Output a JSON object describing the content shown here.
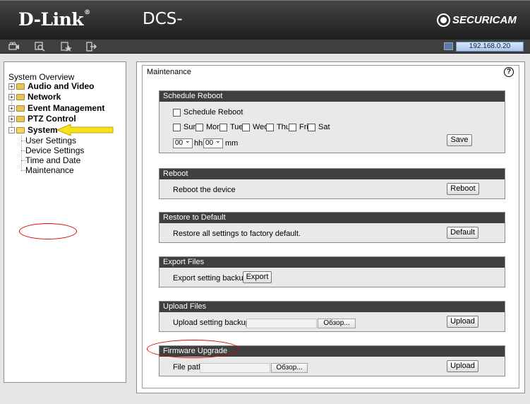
{
  "header": {
    "logo": "D-Link",
    "logo_mark": "®",
    "model": "DCS-",
    "brand": "SECURICAM"
  },
  "toolbar": {
    "icons": [
      "camera-icon",
      "search-camera-icon",
      "star-icon",
      "exit-icon"
    ],
    "ip_address": "192.168.0.20"
  },
  "sidebar": {
    "overview": "System Overview",
    "items": [
      {
        "label": "Audio and Video",
        "expander": "+"
      },
      {
        "label": "Network",
        "expander": "+"
      },
      {
        "label": "Event Management",
        "expander": "+"
      },
      {
        "label": "PTZ Control",
        "expander": "+"
      },
      {
        "label": "System",
        "expander": "-"
      }
    ],
    "system_children": [
      "User Settings",
      "Device Settings",
      "Time and Date",
      "Maintenance"
    ]
  },
  "maintenance": {
    "title": "Maintenance",
    "help": "?",
    "schedule_reboot": {
      "title": "Schedule Reboot",
      "checkbox_label": "Schedule Reboot",
      "days": [
        "Sun",
        "Mon",
        "Tue",
        "Wed",
        "Thu",
        "Fri",
        "Sat"
      ],
      "hour": "00",
      "hour_unit": "hh",
      "minute": "00",
      "minute_unit": "mm",
      "save": "Save"
    },
    "reboot": {
      "title": "Reboot",
      "text": "Reboot the device",
      "button": "Reboot"
    },
    "restore": {
      "title": "Restore to Default",
      "text": "Restore all settings to factory default.",
      "button": "Default"
    },
    "export": {
      "title": "Export Files",
      "text": "Export setting backup file",
      "button": "Export"
    },
    "upload": {
      "title": "Upload Files",
      "text": "Upload setting backup file",
      "browse": "Обзор...",
      "button": "Upload"
    },
    "firmware": {
      "title": "Firmware Upgrade",
      "text": "File path",
      "browse": "Обзор...",
      "button": "Upload"
    }
  },
  "colors": {
    "highlight_arrow": "#f6e21a",
    "annotation_red": "#dd0000",
    "section_header": "#3f3f3f"
  }
}
